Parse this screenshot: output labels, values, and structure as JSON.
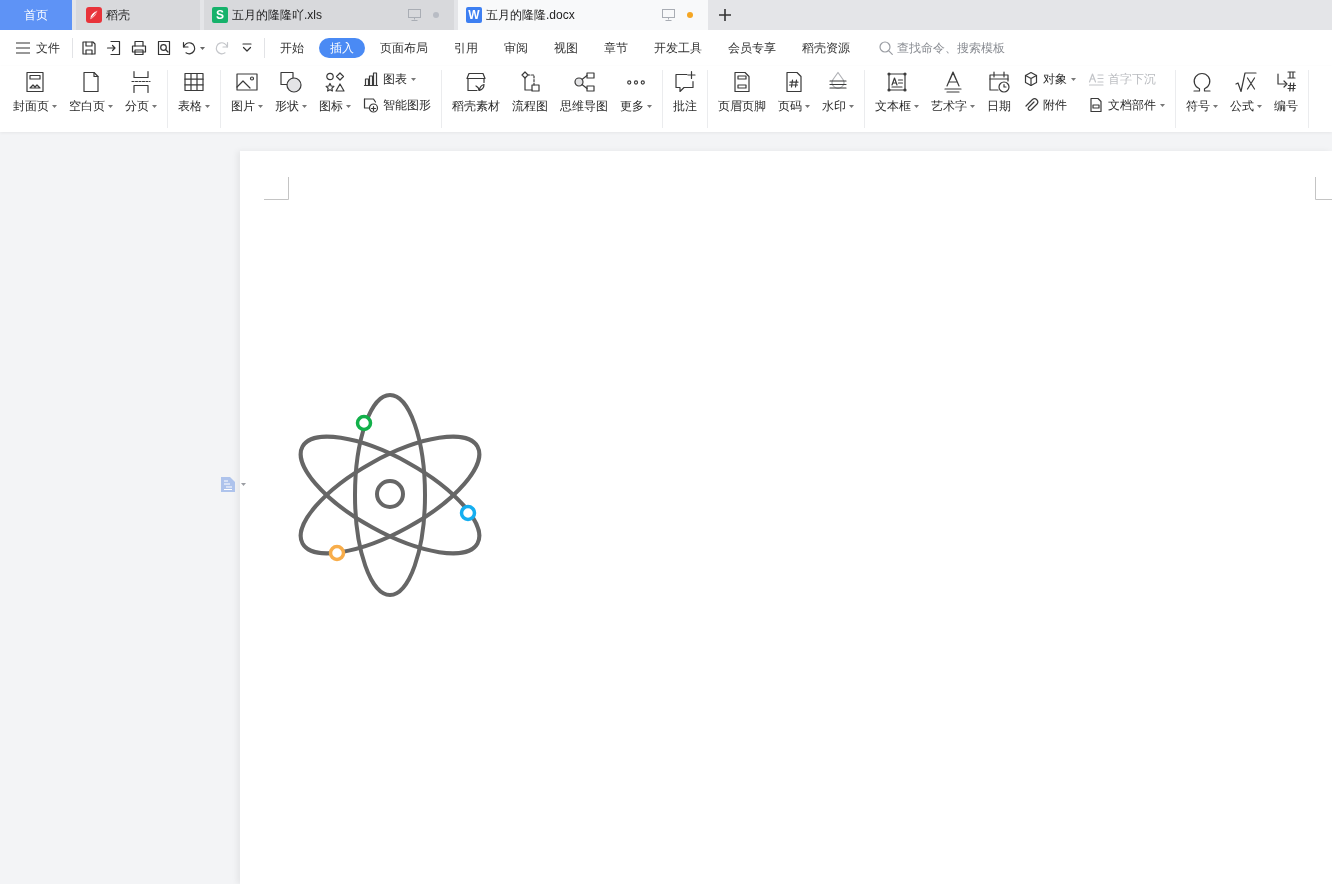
{
  "tabs": [
    {
      "kind": "home",
      "label": "首页",
      "selected": false
    },
    {
      "kind": "docer",
      "label": "稻壳",
      "selected": false
    },
    {
      "kind": "sheet",
      "logo": "S",
      "label": "五月的隆隆吖.xls",
      "selected": false,
      "modified": false
    },
    {
      "kind": "writer",
      "logo": "W",
      "label": "五月的隆隆.docx",
      "selected": true,
      "modified": true
    }
  ],
  "toolbar": {
    "file_menu": "文件",
    "quick_access": [
      {
        "disabled": false
      },
      {
        "disabled": false
      },
      {
        "disabled": false
      },
      {
        "disabled": false
      },
      {
        "disabled": false
      },
      {
        "disabled": true
      },
      {
        "disabled": false
      }
    ],
    "menu_tabs": [
      {
        "label": "开始",
        "selected": false
      },
      {
        "label": "插入",
        "selected": true
      },
      {
        "label": "页面布局",
        "selected": false
      },
      {
        "label": "引用",
        "selected": false
      },
      {
        "label": "审阅",
        "selected": false
      },
      {
        "label": "视图",
        "selected": false
      },
      {
        "label": "章节",
        "selected": false
      },
      {
        "label": "开发工具",
        "selected": false
      },
      {
        "label": "会员专享",
        "selected": false
      },
      {
        "label": "稻壳资源",
        "selected": false
      }
    ],
    "search": {
      "placeholder": "查找命令、搜索模板"
    }
  },
  "ribbon": {
    "groups": [
      {
        "items": [
          {
            "kind": "large",
            "label": "封面页",
            "dropdown": true
          },
          {
            "kind": "large",
            "label": "空白页",
            "dropdown": true
          },
          {
            "kind": "large",
            "label": "分页",
            "dropdown": true
          }
        ]
      },
      {
        "items": [
          {
            "kind": "large",
            "label": "表格",
            "dropdown": true
          }
        ]
      },
      {
        "items": [
          {
            "kind": "large",
            "label": "图片",
            "dropdown": true
          },
          {
            "kind": "large",
            "label": "形状",
            "dropdown": true
          },
          {
            "kind": "large",
            "label": "图标",
            "dropdown": true
          },
          {
            "kind": "stack",
            "items": [
              {
                "label": "图表",
                "dropdown": true,
                "disabled": false
              },
              {
                "label": "智能图形",
                "dropdown": false,
                "disabled": false
              }
            ]
          }
        ]
      },
      {
        "items": [
          {
            "kind": "large",
            "label": "稻壳素材",
            "dropdown": false
          },
          {
            "kind": "large",
            "label": "流程图",
            "dropdown": false
          },
          {
            "kind": "large",
            "label": "思维导图",
            "dropdown": false
          },
          {
            "kind": "large",
            "label": "更多",
            "dropdown": true
          }
        ]
      },
      {
        "items": [
          {
            "kind": "large",
            "label": "批注",
            "dropdown": false
          }
        ]
      },
      {
        "items": [
          {
            "kind": "large",
            "label": "页眉页脚",
            "dropdown": false
          },
          {
            "kind": "large",
            "label": "页码",
            "dropdown": true
          },
          {
            "kind": "large",
            "label": "水印",
            "dropdown": true
          }
        ]
      },
      {
        "items": [
          {
            "kind": "large",
            "label": "文本框",
            "dropdown": true
          },
          {
            "kind": "large",
            "label": "艺术字",
            "dropdown": true
          },
          {
            "kind": "large",
            "label": "日期",
            "dropdown": false
          },
          {
            "kind": "stack",
            "items": [
              {
                "label": "对象",
                "dropdown": true,
                "disabled": false
              },
              {
                "label": "附件",
                "dropdown": false,
                "disabled": false
              }
            ]
          },
          {
            "kind": "stack",
            "items": [
              {
                "label": "首字下沉",
                "dropdown": false,
                "disabled": true
              },
              {
                "label": "文档部件",
                "dropdown": true,
                "disabled": false
              }
            ]
          }
        ]
      },
      {
        "items": [
          {
            "kind": "large",
            "label": "符号",
            "dropdown": true
          },
          {
            "kind": "large",
            "label": "公式",
            "dropdown": true
          },
          {
            "kind": "large",
            "label": "编号",
            "dropdown": false
          }
        ]
      }
    ]
  }
}
